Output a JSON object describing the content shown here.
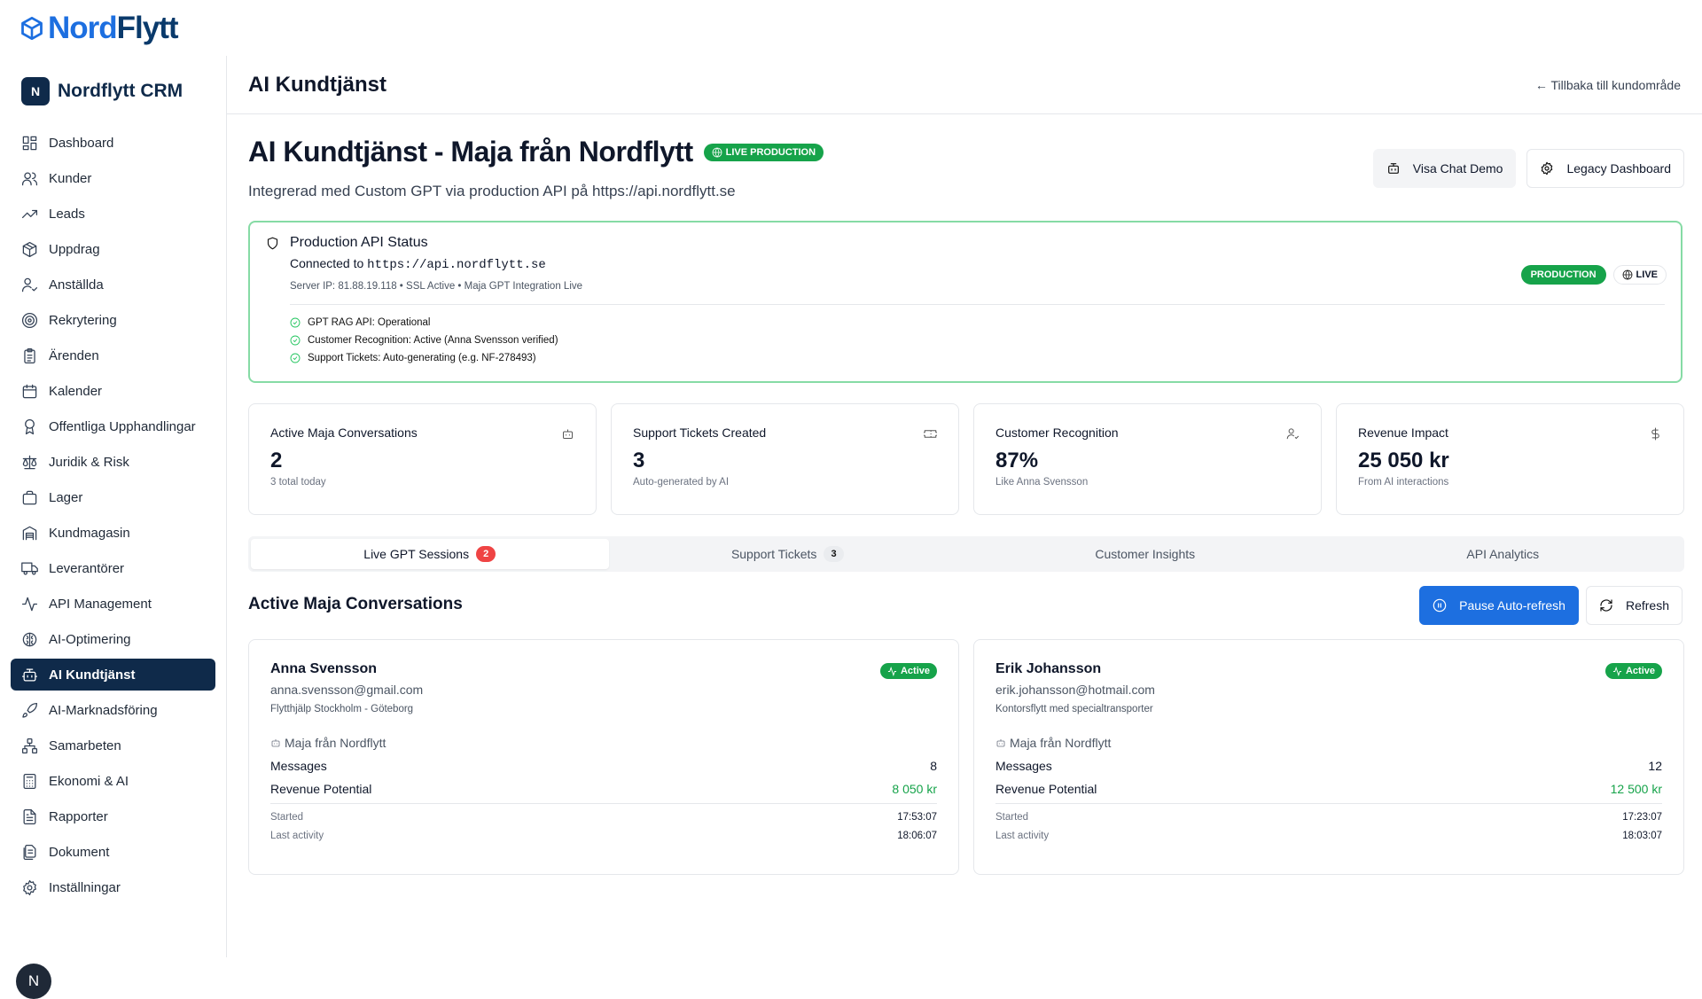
{
  "logo": {
    "nord": "Nord",
    "flytt": "Flytt"
  },
  "brand": {
    "badge": "N",
    "name": "Nordflytt CRM"
  },
  "nav": [
    {
      "label": "Dashboard",
      "icon": "dashboard-icon"
    },
    {
      "label": "Kunder",
      "icon": "users-icon"
    },
    {
      "label": "Leads",
      "icon": "trending-up-icon"
    },
    {
      "label": "Uppdrag",
      "icon": "package-icon"
    },
    {
      "label": "Anställda",
      "icon": "user-check-icon"
    },
    {
      "label": "Rekrytering",
      "icon": "target-icon"
    },
    {
      "label": "Ärenden",
      "icon": "clipboard-icon"
    },
    {
      "label": "Kalender",
      "icon": "calendar-icon"
    },
    {
      "label": "Offentliga Upphandlingar",
      "icon": "award-icon"
    },
    {
      "label": "Juridik & Risk",
      "icon": "scale-icon"
    },
    {
      "label": "Lager",
      "icon": "briefcase-icon"
    },
    {
      "label": "Kundmagasin",
      "icon": "warehouse-icon"
    },
    {
      "label": "Leverantörer",
      "icon": "truck-icon"
    },
    {
      "label": "API Management",
      "icon": "activity-icon"
    },
    {
      "label": "AI-Optimering",
      "icon": "brain-icon"
    },
    {
      "label": "AI Kundtjänst",
      "icon": "bot-icon",
      "active": true
    },
    {
      "label": "AI-Marknadsföring",
      "icon": "rocket-icon"
    },
    {
      "label": "Samarbeten",
      "icon": "network-icon"
    },
    {
      "label": "Ekonomi & AI",
      "icon": "calculator-icon"
    },
    {
      "label": "Rapporter",
      "icon": "file-chart-icon"
    },
    {
      "label": "Dokument",
      "icon": "documents-icon"
    },
    {
      "label": "Inställningar",
      "icon": "gear-icon"
    }
  ],
  "avatar": "N",
  "header": {
    "title": "AI Kundtjänst",
    "back": "← Tillbaka till kundområde"
  },
  "hero": {
    "title": "AI Kundtjänst - Maja från Nordflytt",
    "badge": "LIVE PRODUCTION",
    "subtitle": "Integrerad med Custom GPT via production API på https://api.nordflytt.se",
    "btn_demo": "Visa Chat Demo",
    "btn_legacy": "Legacy Dashboard"
  },
  "status": {
    "title": "Production API Status",
    "connected_prefix": "Connected to ",
    "url": "https://api.nordflytt.se",
    "meta": "Server IP: 81.88.19.118 • SSL Active • Maja GPT Integration Live",
    "badge_prod": "PRODUCTION",
    "badge_live": "LIVE",
    "checks": [
      "GPT RAG API: Operational",
      "Customer Recognition: Active (Anna Svensson verified)",
      "Support Tickets: Auto-generating (e.g. NF-278493)"
    ]
  },
  "kpis": [
    {
      "label": "Active Maja Conversations",
      "value": "2",
      "sub": "3 total today",
      "icon": "bot-icon"
    },
    {
      "label": "Support Tickets Created",
      "value": "3",
      "sub": "Auto-generated by AI",
      "icon": "ticket-icon"
    },
    {
      "label": "Customer Recognition",
      "value": "87%",
      "sub": "Like Anna Svensson",
      "icon": "user-check-icon"
    },
    {
      "label": "Revenue Impact",
      "value": "25 050 kr",
      "sub": "From AI interactions",
      "icon": "dollar-icon"
    }
  ],
  "tabs": [
    {
      "label": "Live GPT Sessions",
      "count": "2"
    },
    {
      "label": "Support Tickets",
      "count": "3"
    },
    {
      "label": "Customer Insights"
    },
    {
      "label": "API Analytics"
    }
  ],
  "section": {
    "title": "Active Maja Conversations",
    "pause": "Pause Auto-refresh",
    "refresh": "Refresh"
  },
  "conversations": [
    {
      "name": "Anna Svensson",
      "email": "anna.svensson@gmail.com",
      "type": "Flytthjälp Stockholm - Göteborg",
      "status": "Active",
      "agent": "Maja från Nordflytt",
      "messages_label": "Messages",
      "messages": "8",
      "revenue_label": "Revenue Potential",
      "revenue": "8 050 kr",
      "started_label": "Started",
      "started": "17:53:07",
      "last_label": "Last activity",
      "last": "18:06:07"
    },
    {
      "name": "Erik Johansson",
      "email": "erik.johansson@hotmail.com",
      "type": "Kontorsflytt med specialtransporter",
      "status": "Active",
      "agent": "Maja från Nordflytt",
      "messages_label": "Messages",
      "messages": "12",
      "revenue_label": "Revenue Potential",
      "revenue": "12 500 kr",
      "started_label": "Started",
      "started": "17:23:07",
      "last_label": "Last activity",
      "last": "18:03:07"
    }
  ]
}
